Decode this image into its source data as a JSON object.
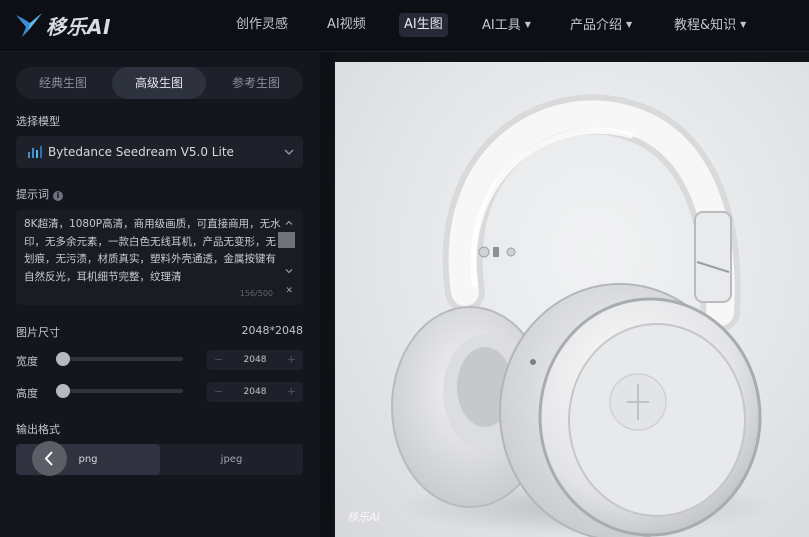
{
  "brand": {
    "name": "移乐AI"
  },
  "nav": {
    "items": [
      {
        "label": "创作灵感",
        "active": false,
        "has_caret": false
      },
      {
        "label": "AI视频",
        "active": false,
        "has_caret": false
      },
      {
        "label": "AI生图",
        "active": true,
        "has_caret": false
      },
      {
        "label": "AI工具",
        "active": false,
        "has_caret": true
      },
      {
        "label": "产品介绍",
        "active": false,
        "has_caret": true
      },
      {
        "label": "教程&知识",
        "active": false,
        "has_caret": true
      }
    ]
  },
  "mode_tabs": [
    {
      "label": "经典生图",
      "active": false
    },
    {
      "label": "高级生图",
      "active": true
    },
    {
      "label": "参考生图",
      "active": false
    }
  ],
  "model": {
    "label": "选择模型",
    "value": "Bytedance Seedream V5.0 Lite"
  },
  "prompt": {
    "label": "提示词",
    "text": "8K超清，1080P高清，商用级画质，可直接商用，无水印，无多余元素，一款白色无线耳机，产品无变形，无划痕，无污渍，材质真实，塑料外壳通透，金属按键有自然反光，耳机细节完整，纹理清",
    "counter": "156/500"
  },
  "size": {
    "label": "图片尺寸",
    "value": "2048*2048",
    "width": {
      "label": "宽度",
      "value": "2048",
      "slider_fraction": 0.05
    },
    "height": {
      "label": "高度",
      "value": "2048",
      "slider_fraction": 0.05
    }
  },
  "output_format": {
    "label": "输出格式",
    "options": [
      {
        "label": "png",
        "active": true
      },
      {
        "label": "jpeg",
        "active": false
      }
    ]
  },
  "preview": {
    "watermark": "移乐AI"
  },
  "colors": {
    "background": "#111319",
    "panel": "#14161d",
    "logo_accent": "#4aa8e8"
  }
}
